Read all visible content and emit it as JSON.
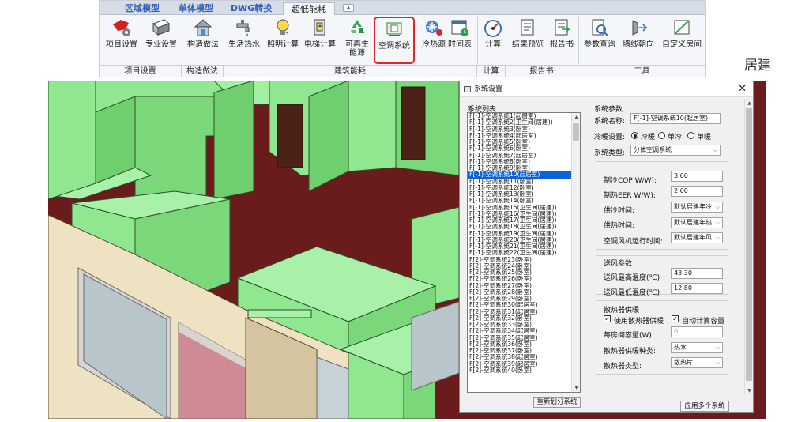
{
  "ribbon": {
    "tabs": [
      "区域模型",
      "单体模型",
      "DWG转换",
      "超低能耗"
    ],
    "buttons": [
      {
        "label": "项目设置",
        "icon": "map-gear-icon"
      },
      {
        "label": "专业设置",
        "icon": "folder-gear-icon"
      },
      {
        "label": "构造做法",
        "icon": "house-icon"
      },
      {
        "label": "生活热水",
        "icon": "faucet-icon"
      },
      {
        "label": "照明计算",
        "icon": "bulb-icon"
      },
      {
        "label": "电梯计算",
        "icon": "elevator-icon"
      },
      {
        "label": "可再生\n能源",
        "icon": "recycle-icon"
      },
      {
        "label": "空调系统",
        "icon": "ac-system-icon"
      },
      {
        "label": "冷热源",
        "icon": "snowflake-sun-icon"
      },
      {
        "label": "时间表",
        "icon": "schedule-icon"
      },
      {
        "label": "计算",
        "icon": "gauge-icon"
      },
      {
        "label": "结果预览",
        "icon": "preview-icon"
      },
      {
        "label": "报告书",
        "icon": "report-icon"
      },
      {
        "label": "参数查询",
        "icon": "search-doc-icon"
      },
      {
        "label": "墙线朝向",
        "icon": "compass-icon"
      },
      {
        "label": "自定义房间",
        "icon": "custom-room-icon"
      }
    ],
    "groups": [
      "项目设置",
      "构造做法",
      "建筑能耗",
      "计算",
      "报告书",
      "工具"
    ]
  },
  "brand_text": "居建",
  "dialog": {
    "title": "系统设置",
    "list_label": "系统列表",
    "systems": [
      "F[-1]-空调系统1(起居室)",
      "F[-1]-空调系统2(卫生间(居建))",
      "F[-1]-空调系统3(卧室)",
      "F[-1]-空调系统4(起居室)",
      "F[-1]-空调系统5(卧室)",
      "F[-1]-空调系统6(卧室)",
      "F[-1]-空调系统7(起居室)",
      "F[-1]-空调系统8(卧室)",
      "F[-1]-空调系统9(卧室)",
      "F[-1]-空调系统10(起居室)",
      "F[-1]-空调系统11(卧室)",
      "F[-1]-空调系统12(卧室)",
      "F[-1]-空调系统13(卧室)",
      "F[-1]-空调系统14(卧室)",
      "F[-1]-空调系统15(卫生间(居建))",
      "F[-1]-空调系统16(卫生间(居建))",
      "F[-1]-空调系统17(卫生间(居建))",
      "F[-1]-空调系统18(卫生间(居建))",
      "F[-1]-空调系统19(卫生间(居建))",
      "F[-1]-空调系统20(卫生间(居建))",
      "F[-1]-空调系统21(卫生间(居建))",
      "F[-1]-空调系统22(卫生间(居建))",
      "F[2]-空调系统23(卧室)",
      "F[2]-空调系统24(卧室)",
      "F[2]-空调系统25(卧室)",
      "F[2]-空调系统26(卧室)",
      "F[2]-空调系统27(卧室)",
      "F[2]-空调系统28(卧室)",
      "F[2]-空调系统29(卧室)",
      "F[2]-空调系统30(起居室)",
      "F[2]-空调系统31(起居室)",
      "F[2]-空调系统32(卧室)",
      "F[2]-空调系统33(卧室)",
      "F[2]-空调系统34(起居室)",
      "F[2]-空调系统35(起居室)",
      "F[2]-空调系统36(卧室)",
      "F[2]-空调系统37(卧室)",
      "F[2]-空调系统38(起居室)",
      "F[2]-空调系统39(起居室)",
      "F[2]-空调系统40(卧室)"
    ],
    "selected_index": 9,
    "redivide_button": "重新划分系统",
    "params_label": "系统参数",
    "name_label": "系统名称:",
    "name_value": "F[-1]-空调系统10(起居室)",
    "mode_label": "冷暖设置:",
    "mode_options": [
      "冷暖",
      "单冷",
      "单暖"
    ],
    "mode_selected": 0,
    "type_label": "系统类型:",
    "type_value": "分体空调系统",
    "cop_label": "制冷COP W/W):",
    "cop_value": "3.60",
    "eer_label": "制热EER W/W):",
    "eer_value": "2.60",
    "cool_time_label": "供冷时间:",
    "cool_time_value": "默认居建年冷",
    "heat_time_label": "供热时间:",
    "heat_time_value": "默认居建年热",
    "fan_time_label": "空调风机运行时间:",
    "fan_time_value": "默认居建年风",
    "supply_label": "送风参数",
    "supply_max_label": "送风最高温度(℃)",
    "supply_max_value": "43.30",
    "supply_min_label": "送风最低温度(℃)",
    "supply_min_value": "12.80",
    "radiator_label": "散热器供暖",
    "use_radiator_label": "使用散热器供暖",
    "auto_calc_label": "自动计算容量",
    "capacity_label": "每房间容量(W):",
    "capacity_value": "0",
    "medium_label": "散热器供暖种类:",
    "medium_value": "热水",
    "rad_type_label": "散热器类型:",
    "rad_type_value": "散热片",
    "apply_button": "应用多个系统"
  },
  "colors": {
    "accent_red": "#e0262b",
    "wall_green": "#8fe88f",
    "floor_red": "#6a1c1c",
    "selection_blue": "#0a63d8"
  }
}
